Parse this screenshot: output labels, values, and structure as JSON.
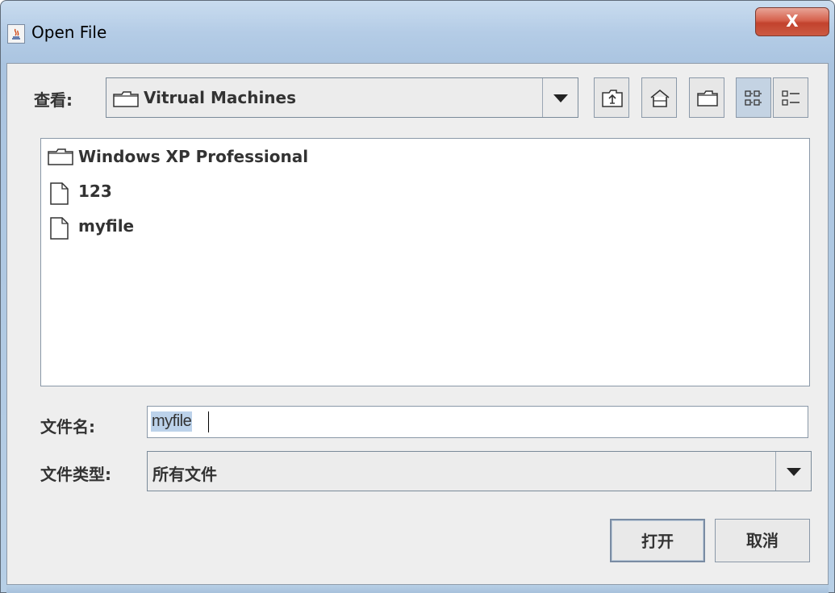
{
  "window": {
    "title": "Open File",
    "close_label": "X"
  },
  "lookin": {
    "label": "查看:",
    "value": "Vitrual Machines"
  },
  "toolbar": {
    "buttons": [
      {
        "name": "up-one-level-icon"
      },
      {
        "name": "home-icon"
      },
      {
        "name": "new-folder-icon"
      },
      {
        "name": "list-view-icon"
      },
      {
        "name": "details-view-icon"
      }
    ]
  },
  "files": [
    {
      "name": "Windows XP Professional",
      "type": "folder"
    },
    {
      "name": "123",
      "type": "file"
    },
    {
      "name": "myfile",
      "type": "file"
    }
  ],
  "filename": {
    "label": "文件名:",
    "value": "myfile"
  },
  "filetype": {
    "label": "文件类型:",
    "value": "所有文件"
  },
  "buttons": {
    "open": "打开",
    "cancel": "取消"
  },
  "colors": {
    "titlebar": "#b4cce6",
    "close_button": "#c2422d",
    "dialog_background": "#eeeeee",
    "selection": "#bcd2ea"
  }
}
